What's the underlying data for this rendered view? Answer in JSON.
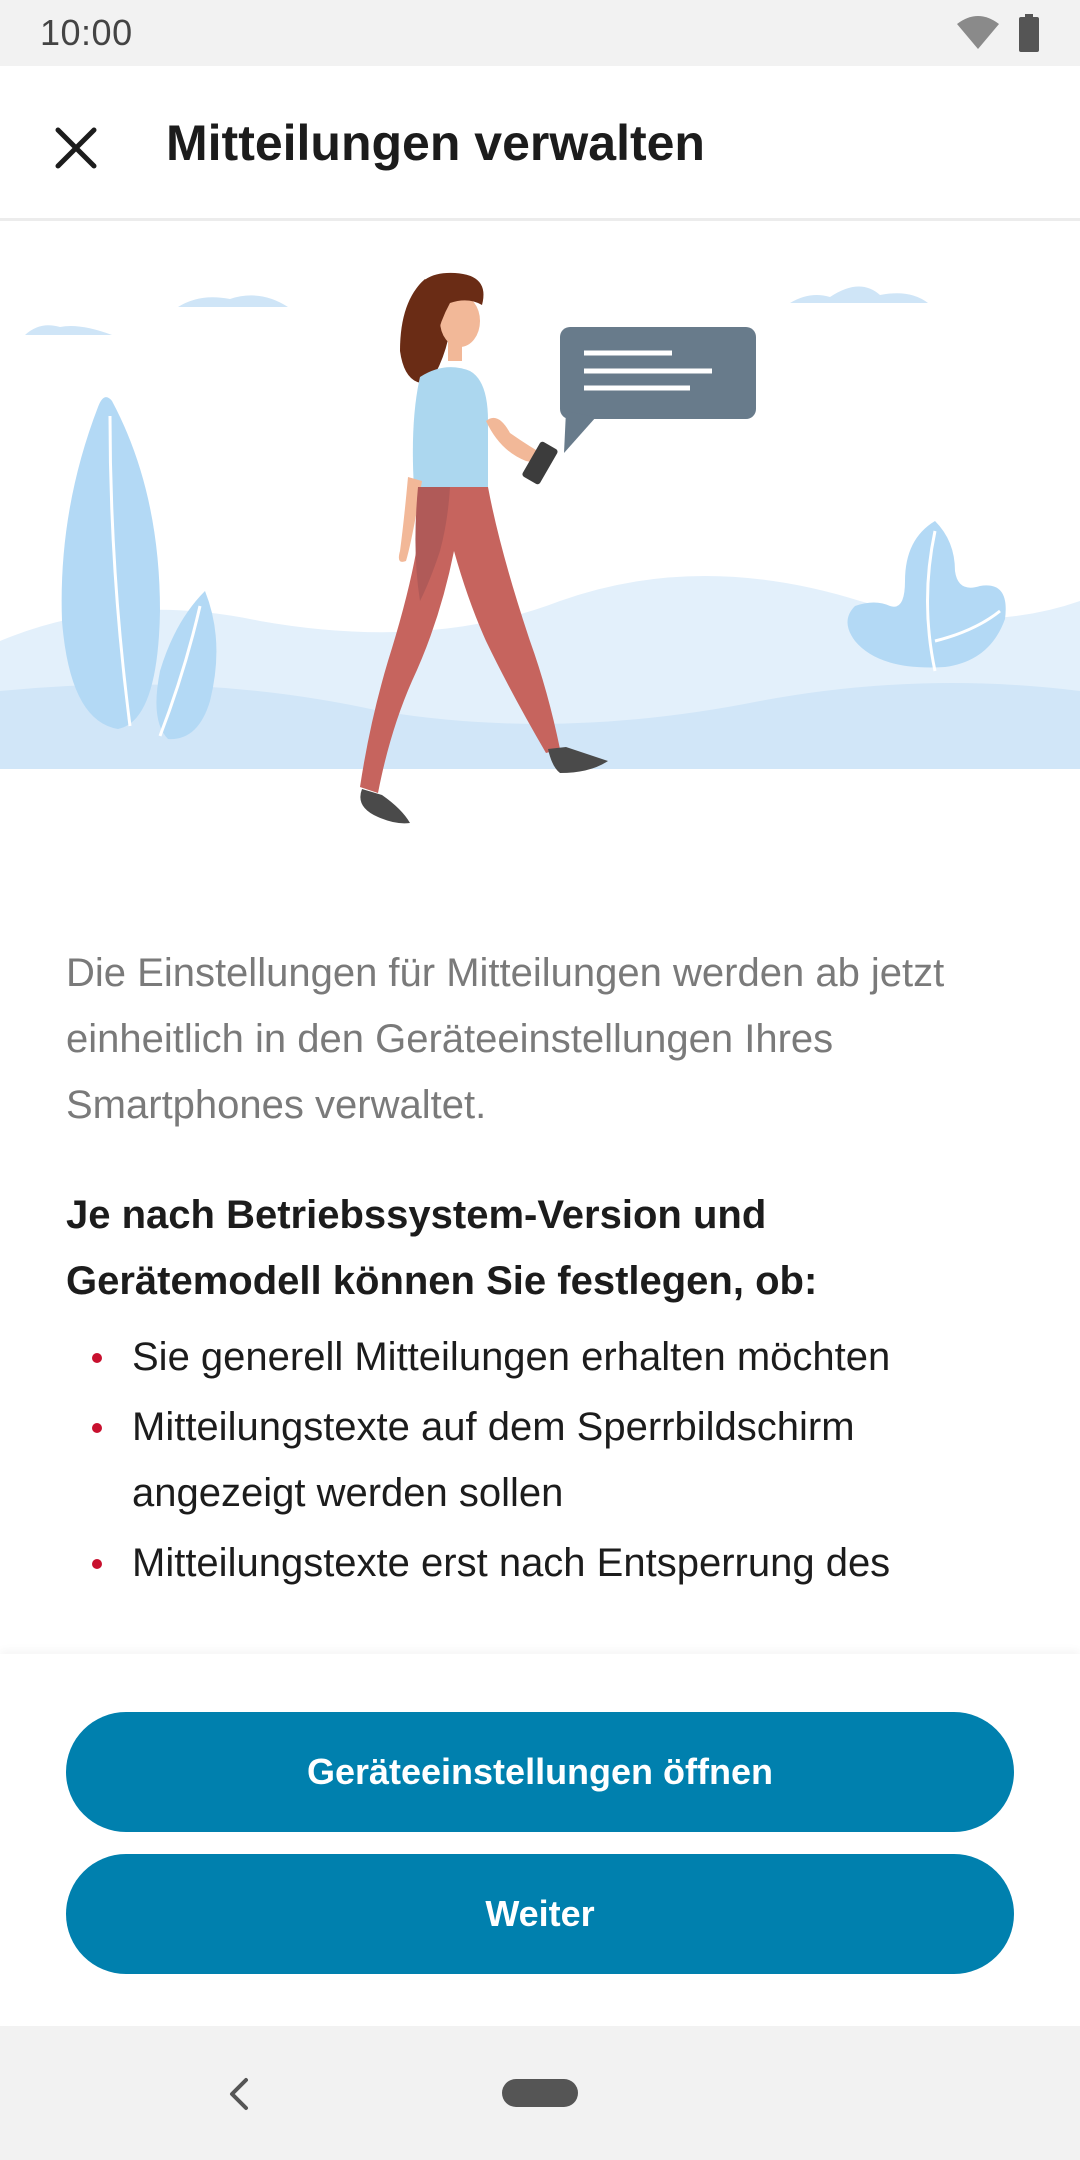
{
  "status_bar": {
    "time": "10:00"
  },
  "app_bar": {
    "title": "Mitteilungen verwalten",
    "close_icon": "close-icon"
  },
  "content": {
    "intro": "Die Einstellungen für Mitteilungen werden ab jetzt einheitlich in den Geräteeinstellungen Ihres Smartphones verwaltet.",
    "list_heading": "Je nach Betriebssystem-Version und Gerätemodell können Sie festlegen, ob:",
    "items": [
      "Sie generell Mitteilungen erhalten möchten",
      "Mitteilungstexte auf dem Sperrbildschirm angezeigt werden sollen",
      "Mitteilungstexte erst nach Entsperrung des"
    ]
  },
  "buttons": {
    "open_settings": "Geräteeinstellungen öffnen",
    "next": "Weiter"
  },
  "colors": {
    "primary": "#0080ae",
    "bullet": "#c8102e",
    "title": "#1c1c1c",
    "muted_text": "#7a7a7a"
  }
}
